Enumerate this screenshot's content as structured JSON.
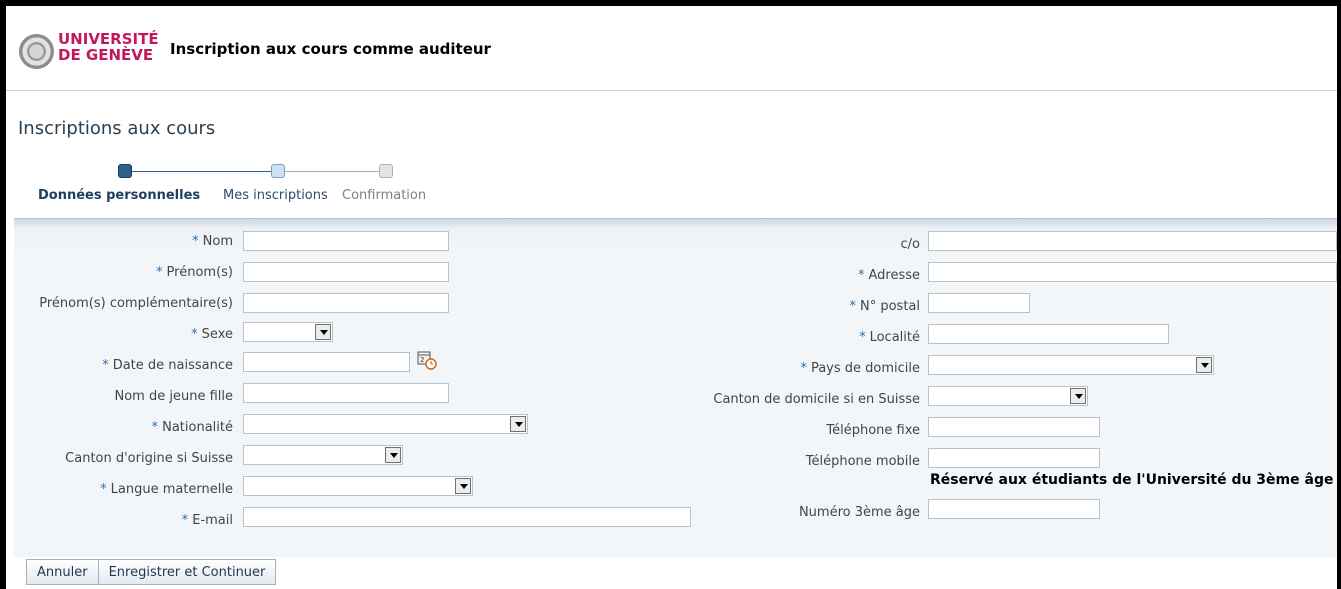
{
  "header": {
    "logo_line1": "UNIVERSITÉ",
    "logo_line2": "DE GENÈVE",
    "app_title": "Inscription aux cours comme auditeur"
  },
  "page": {
    "title": "Inscriptions aux cours"
  },
  "train": {
    "steps": [
      {
        "label": "Données personnelles",
        "state": "current"
      },
      {
        "label": "Mes inscriptions",
        "state": "next"
      },
      {
        "label": "Confirmation",
        "state": "disabled"
      }
    ]
  },
  "form": {
    "required_mark": "*",
    "left": {
      "nom": {
        "label": "Nom",
        "value": ""
      },
      "prenom": {
        "label": "Prénom(s)",
        "value": ""
      },
      "prenom_compl": {
        "label": "Prénom(s) complémentaire(s)",
        "value": ""
      },
      "sexe": {
        "label": "Sexe",
        "value": ""
      },
      "date_naissance": {
        "label": "Date de naissance",
        "value": ""
      },
      "nom_jeune_fille": {
        "label": "Nom de jeune fille",
        "value": ""
      },
      "nationalite": {
        "label": "Nationalité",
        "value": ""
      },
      "canton_origine": {
        "label": "Canton d'origine si Suisse",
        "value": ""
      },
      "langue": {
        "label": "Langue maternelle",
        "value": ""
      },
      "email": {
        "label": "E-mail",
        "value": ""
      }
    },
    "right": {
      "co": {
        "label": "c/o",
        "value": ""
      },
      "adresse": {
        "label": "Adresse",
        "value": ""
      },
      "npa": {
        "label": "N° postal",
        "value": ""
      },
      "localite": {
        "label": "Localité",
        "value": ""
      },
      "pays": {
        "label": "Pays de domicile",
        "value": ""
      },
      "canton_domicile": {
        "label": "Canton de domicile si en Suisse",
        "value": ""
      },
      "tel_fixe": {
        "label": "Téléphone fixe",
        "value": ""
      },
      "tel_mobile": {
        "label": "Téléphone mobile",
        "value": ""
      },
      "section_3age": "Réservé aux étudiants de l'Université du 3ème âge",
      "numero_3age": {
        "label": "Numéro 3ème âge",
        "value": ""
      }
    }
  },
  "buttons": {
    "cancel": "Annuler",
    "save_continue": "Enregistrer et Continuer"
  },
  "colors": {
    "brand": "#c2185b",
    "required": "#2a6fb0",
    "title": "#2b4050"
  }
}
